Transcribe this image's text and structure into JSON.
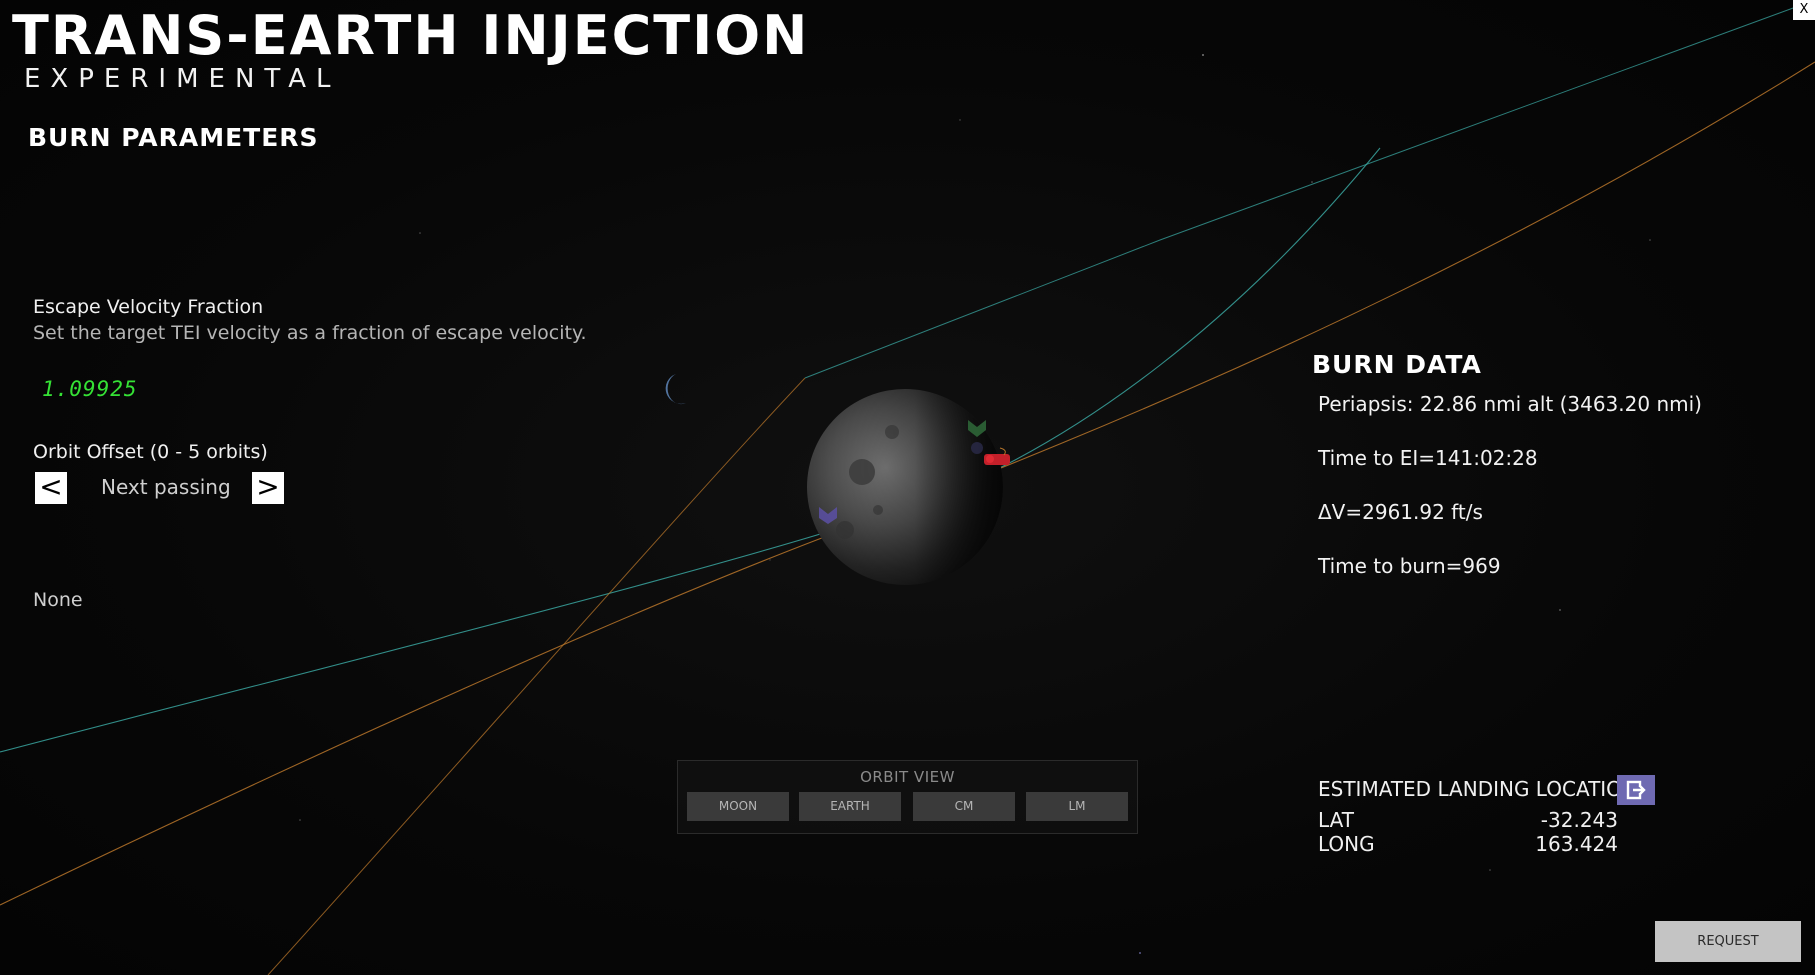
{
  "header": {
    "title": "TRANS-EARTH INJECTION",
    "subtitle": "EXPERIMENTAL",
    "close_label": "X"
  },
  "burn_parameters": {
    "section_title": "BURN PARAMETERS",
    "escape_velocity": {
      "label": "Escape Velocity Fraction",
      "description": "Set the target TEI velocity as a fraction of escape velocity.",
      "value": "1.09925"
    },
    "orbit_offset": {
      "label": "Orbit Offset (0 - 5 orbits)",
      "prev_label": "<",
      "next_label": ">",
      "current": "Next passing"
    },
    "status": "None"
  },
  "burn_data": {
    "section_title": "BURN DATA",
    "periapsis": "Periapsis: 22.86 nmi alt (3463.20 nmi)",
    "time_to_ei": "Time to EI=141:02:28",
    "delta_v": "ΔV=2961.92 ft/s",
    "time_to_burn": "Time to burn=969"
  },
  "orbit_view": {
    "title": "ORBIT VIEW",
    "buttons": [
      "MOON",
      "EARTH",
      "CM",
      "LM"
    ]
  },
  "landing": {
    "title": "ESTIMATED LANDING LOCATION",
    "export_icon": "export-icon",
    "lat_label": "LAT",
    "lat_value": "-32.243",
    "long_label": "LONG",
    "long_value": "163.424"
  },
  "request_label": "REQUEST",
  "colors": {
    "trajectory_cyan": "#3aa6a0",
    "trajectory_orange": "#b8762a",
    "digital_green": "#35e235",
    "export_purple": "#6f6ab2",
    "cm_red": "#c4202a"
  }
}
